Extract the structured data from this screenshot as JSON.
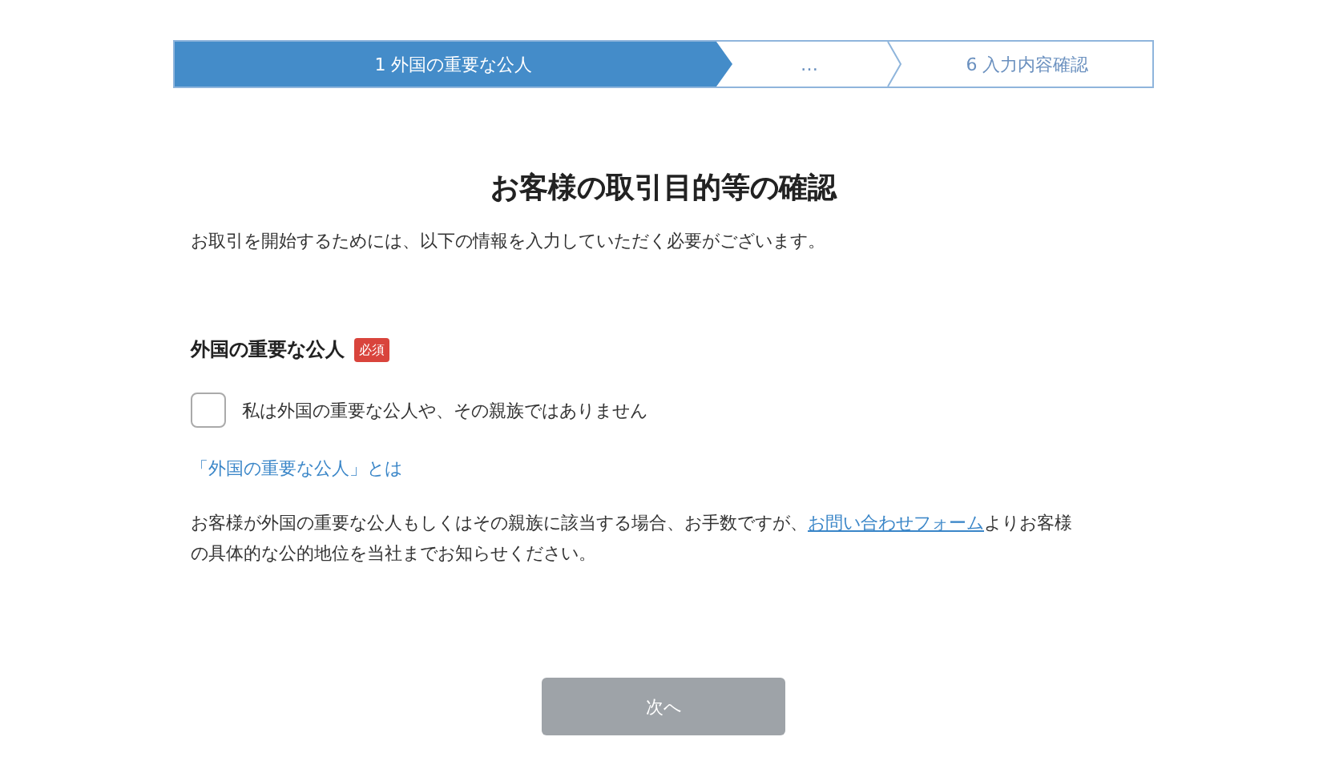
{
  "steps": [
    {
      "label": "1 外国の重要な公人",
      "selected": true
    },
    {
      "label": "…",
      "selected": false
    },
    {
      "label": "6 入力内容確認",
      "selected": false
    }
  ],
  "title": "お客様の取引目的等の確認",
  "intro": "お取引を開始するためには、以下の情報を入力していただく必要がございます。",
  "section": {
    "label": "外国の重要な公人",
    "badge": "必須"
  },
  "checkbox": {
    "label": "私は外国の重要な公人や、その親族ではありません",
    "checked": false
  },
  "info_link": "「外国の重要な公人」とは",
  "notice": {
    "before": "お客様が外国の重要な公人もしくはその親族に該当する場合、お手数ですが、",
    "link": "お問い合わせフォーム",
    "after": "よりお客様の具体的な公的地位を当社までお知らせください。"
  },
  "next_button": {
    "label": "次へ",
    "disabled": true
  }
}
